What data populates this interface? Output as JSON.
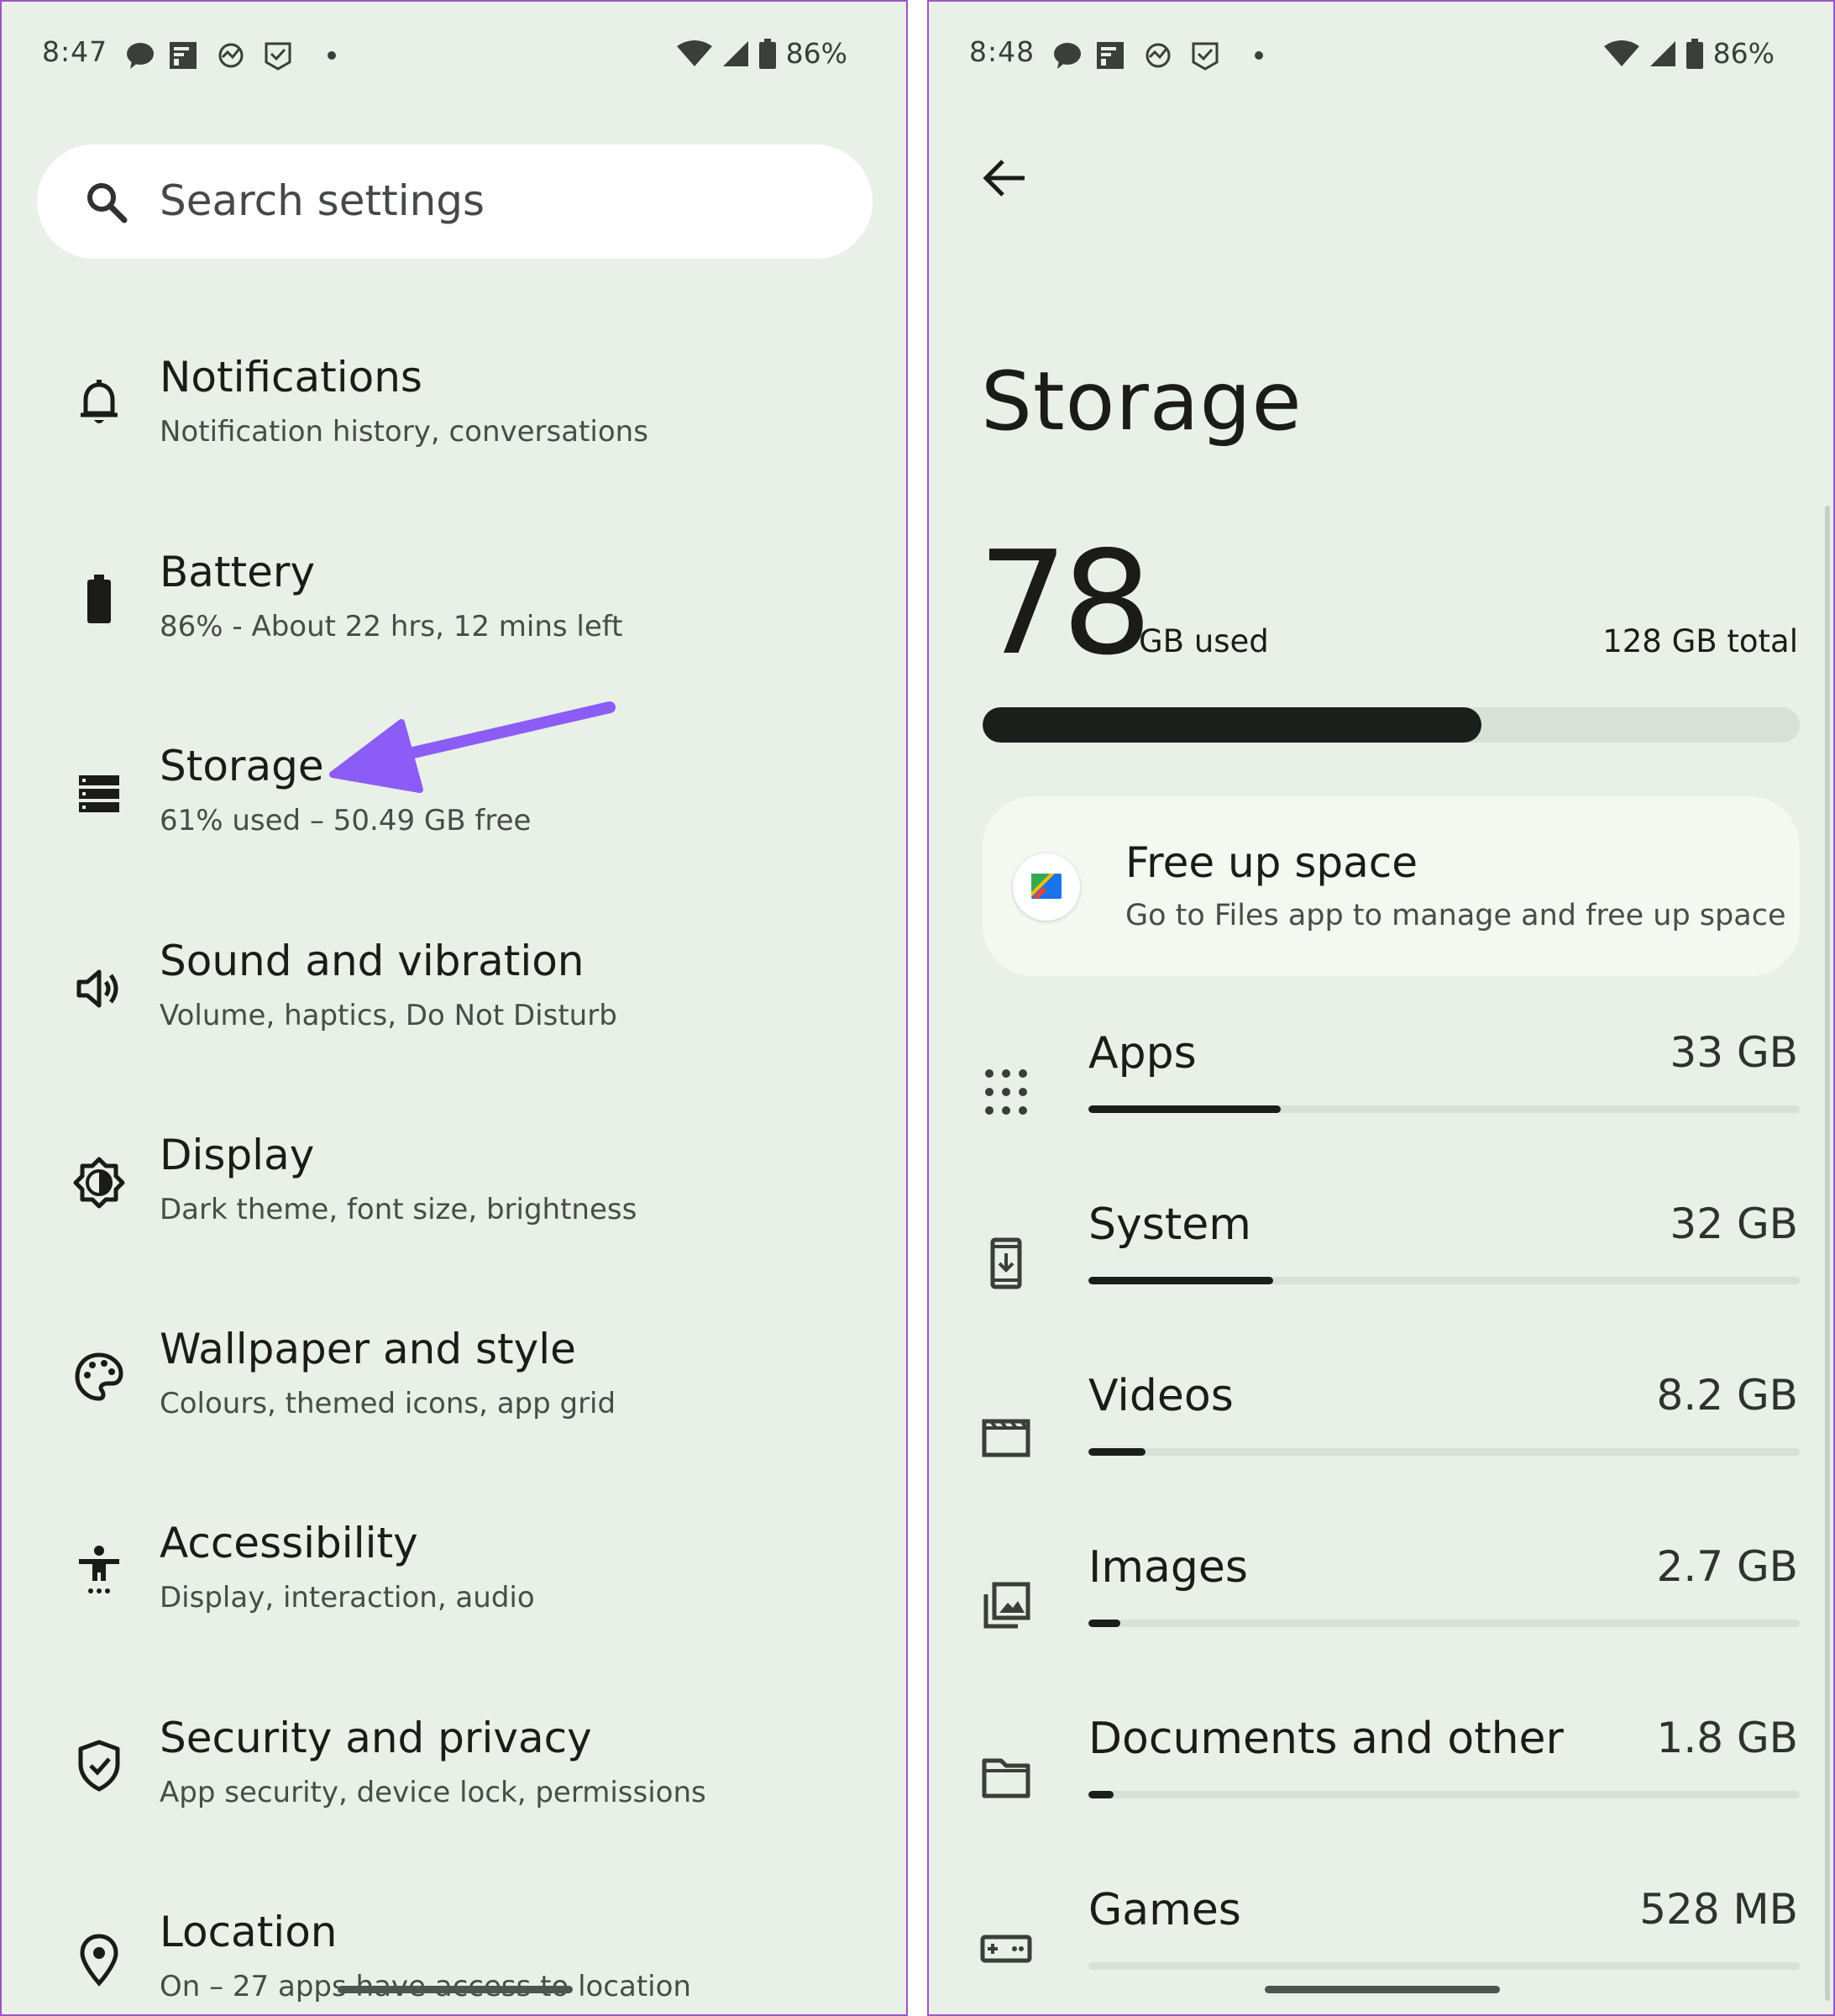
{
  "left_screen": {
    "status_bar": {
      "time": "8:47",
      "battery": "86%"
    },
    "search": {
      "placeholder": "Search settings"
    },
    "items": [
      {
        "icon": "bell-icon",
        "title": "Notifications",
        "subtitle": "Notification history, conversations"
      },
      {
        "icon": "battery-icon",
        "title": "Battery",
        "subtitle": "86% - About 22 hrs, 12 mins left"
      },
      {
        "icon": "storage-icon",
        "title": "Storage",
        "subtitle": "61% used – 50.49 GB free"
      },
      {
        "icon": "speaker-icon",
        "title": "Sound and vibration",
        "subtitle": "Volume, haptics, Do Not Disturb"
      },
      {
        "icon": "brightness-icon",
        "title": "Display",
        "subtitle": "Dark theme, font size, brightness"
      },
      {
        "icon": "palette-icon",
        "title": "Wallpaper and style",
        "subtitle": "Colours, themed icons, app grid"
      },
      {
        "icon": "accessibility-icon",
        "title": "Accessibility",
        "subtitle": "Display, interaction, audio"
      },
      {
        "icon": "shield-icon",
        "title": "Security and privacy",
        "subtitle": "App security, device lock, permissions"
      },
      {
        "icon": "location-pin-icon",
        "title": "Location",
        "subtitle": "On – 27 apps have access to location"
      }
    ],
    "annotation": {
      "type": "arrow",
      "color": "#8b5cf6",
      "points_to": "Storage"
    }
  },
  "right_screen": {
    "status_bar": {
      "time": "8:48",
      "battery": "86%"
    },
    "title": "Storage",
    "used_number": "78",
    "used_unit": "GB used",
    "total": "128 GB total",
    "used_fraction": 0.61,
    "free_up": {
      "title": "Free up space",
      "subtitle": "Go to Files app to manage and free up space"
    },
    "categories": [
      {
        "icon": "apps-grid-icon",
        "label": "Apps",
        "size": "33 GB",
        "fraction": 0.27
      },
      {
        "icon": "system-update-icon",
        "label": "System",
        "size": "32 GB",
        "fraction": 0.26
      },
      {
        "icon": "video-clapper-icon",
        "label": "Videos",
        "size": "8.2 GB",
        "fraction": 0.08
      },
      {
        "icon": "images-icon",
        "label": "Images",
        "size": "2.7 GB",
        "fraction": 0.045
      },
      {
        "icon": "folder-icon",
        "label": "Documents and other",
        "size": "1.8 GB",
        "fraction": 0.035
      },
      {
        "icon": "gamepad-icon",
        "label": "Games",
        "size": "528 MB",
        "fraction": 0.0
      }
    ]
  },
  "colors": {
    "background": "#e9f0e7",
    "border": "#9a55c8",
    "bar_fill": "#1b1f1b",
    "bar_track": "#d7e1d6",
    "annotation_arrow": "#8b5cf6"
  }
}
